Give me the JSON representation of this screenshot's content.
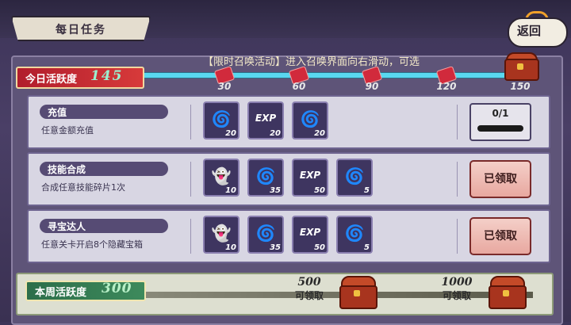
{
  "header": {
    "title": "每日任务",
    "back_label": "返回"
  },
  "marquee": "【限时召唤活动】进入召唤界面向右滑动，可选",
  "today": {
    "label": "今日活跃度",
    "value": "145",
    "milestones": [
      "30",
      "60",
      "90",
      "120"
    ],
    "chest_value": "150"
  },
  "tasks": [
    {
      "name": "充值",
      "desc": "任意金额充值",
      "rewards": [
        {
          "icon": "blue-flame-icon",
          "qty": "20"
        },
        {
          "icon": "exp-icon",
          "label": "EXP",
          "qty": "20"
        },
        {
          "icon": "red-flame-icon",
          "qty": "20"
        }
      ],
      "progress": "0/1"
    },
    {
      "name": "技能合成",
      "desc": "合成任意技能碎片1次",
      "rewards": [
        {
          "icon": "spirit-icon",
          "qty": "10"
        },
        {
          "icon": "blue-flame-icon",
          "qty": "35"
        },
        {
          "icon": "exp-icon",
          "label": "EXP",
          "qty": "50"
        },
        {
          "icon": "red-flame-icon",
          "qty": "5"
        }
      ],
      "claim": "已领取"
    },
    {
      "name": "寻宝达人",
      "desc": "任意关卡开启8个隐藏宝箱",
      "rewards": [
        {
          "icon": "spirit-icon",
          "qty": "10"
        },
        {
          "icon": "blue-flame-icon",
          "qty": "35"
        },
        {
          "icon": "exp-icon",
          "label": "EXP",
          "qty": "50"
        },
        {
          "icon": "red-flame-icon",
          "qty": "5"
        }
      ],
      "claim": "已领取"
    }
  ],
  "weekly": {
    "label": "本周活跃度",
    "value": "300",
    "goals": [
      {
        "value": "500",
        "note": "可领取"
      },
      {
        "value": "1000",
        "note": "可领取"
      }
    ]
  }
}
